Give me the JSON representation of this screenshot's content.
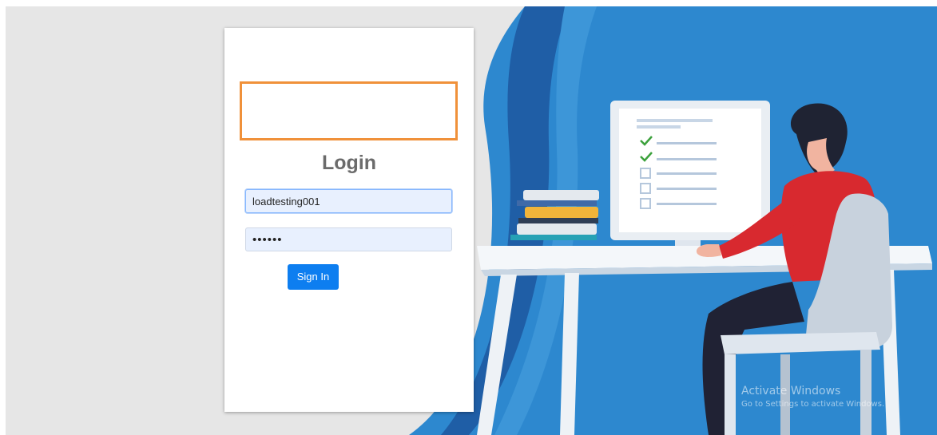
{
  "login": {
    "title": "Login",
    "username_value": "loadtesting001",
    "password_value": "••••••",
    "sign_in_label": "Sign In"
  },
  "watermark": {
    "line1": "Activate Windows",
    "line2": "Go to Settings to activate Windows."
  },
  "colors": {
    "accent": "#0d7ef0",
    "logo_border": "#f0913a",
    "hero_blue": "#2d88cf"
  },
  "illustration": {
    "subject": "person-at-desk-with-computer-and-books",
    "checklist_checked": 2,
    "checklist_total": 5
  }
}
